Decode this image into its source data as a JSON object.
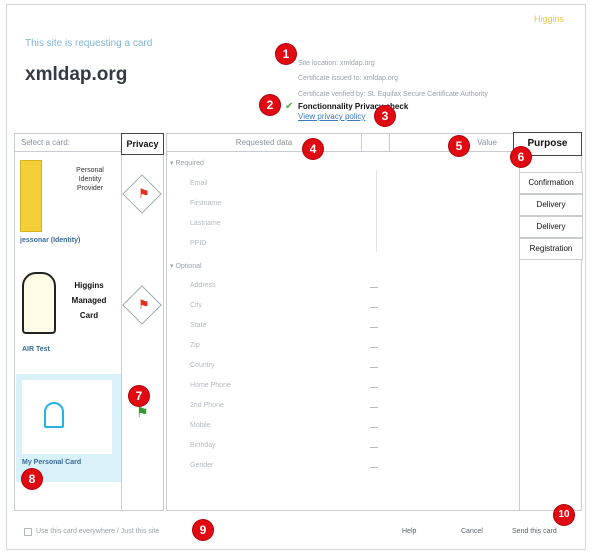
{
  "header": {
    "brand": "Higgins",
    "request_text": "This site is requesting a card",
    "domain": "xmldap.org"
  },
  "site_info": {
    "site_location": "Site location: xmldap.org",
    "cert_issued": "Certificate issued to: xmldap.org",
    "cert_verified": "Certificate verified by: St. Equifax Secure Certificate Authority",
    "privacy_check": "Fonctionnality Privacy check",
    "view_policy": "View privacy policy"
  },
  "cards_panel": {
    "title": "Select a card:",
    "privacy_tab": "Privacy",
    "cards": [
      {
        "name": "jessonar (Identity)",
        "lines": [
          "Personal",
          "Identity",
          "Provider"
        ]
      },
      {
        "name": "AIR Test",
        "lines": [
          "Higgins",
          "Managed",
          "Card"
        ]
      },
      {
        "name": "My Personal Card",
        "lines": []
      }
    ]
  },
  "data_panel": {
    "col_requested": "Requested data",
    "col_value": "Value",
    "col_purpose": "Purpose",
    "required_label": "Required",
    "optional_label": "Optional",
    "required_fields": [
      "Email",
      "Firstname",
      "Lastname",
      "PPID"
    ],
    "optional_fields": [
      "Address",
      "City",
      "State",
      "Zip",
      "Country",
      "Home Phone",
      "2nd Phone",
      "Mobile",
      "Birthday",
      "Gender"
    ],
    "purposes": [
      "Confirmation",
      "Delivery",
      "Delivery",
      "Registration"
    ]
  },
  "footer": {
    "use_everywhere": "Use this card everywhere / Just this site",
    "help": "Help",
    "cancel": "Cancel",
    "send": "Send this card"
  },
  "callouts": [
    "1",
    "2",
    "3",
    "4",
    "5",
    "6",
    "7",
    "8",
    "9",
    "10"
  ],
  "colors": {
    "accent_red": "#e10a12",
    "selected_card": "#d9f2fa",
    "link": "#3a7bbf"
  }
}
